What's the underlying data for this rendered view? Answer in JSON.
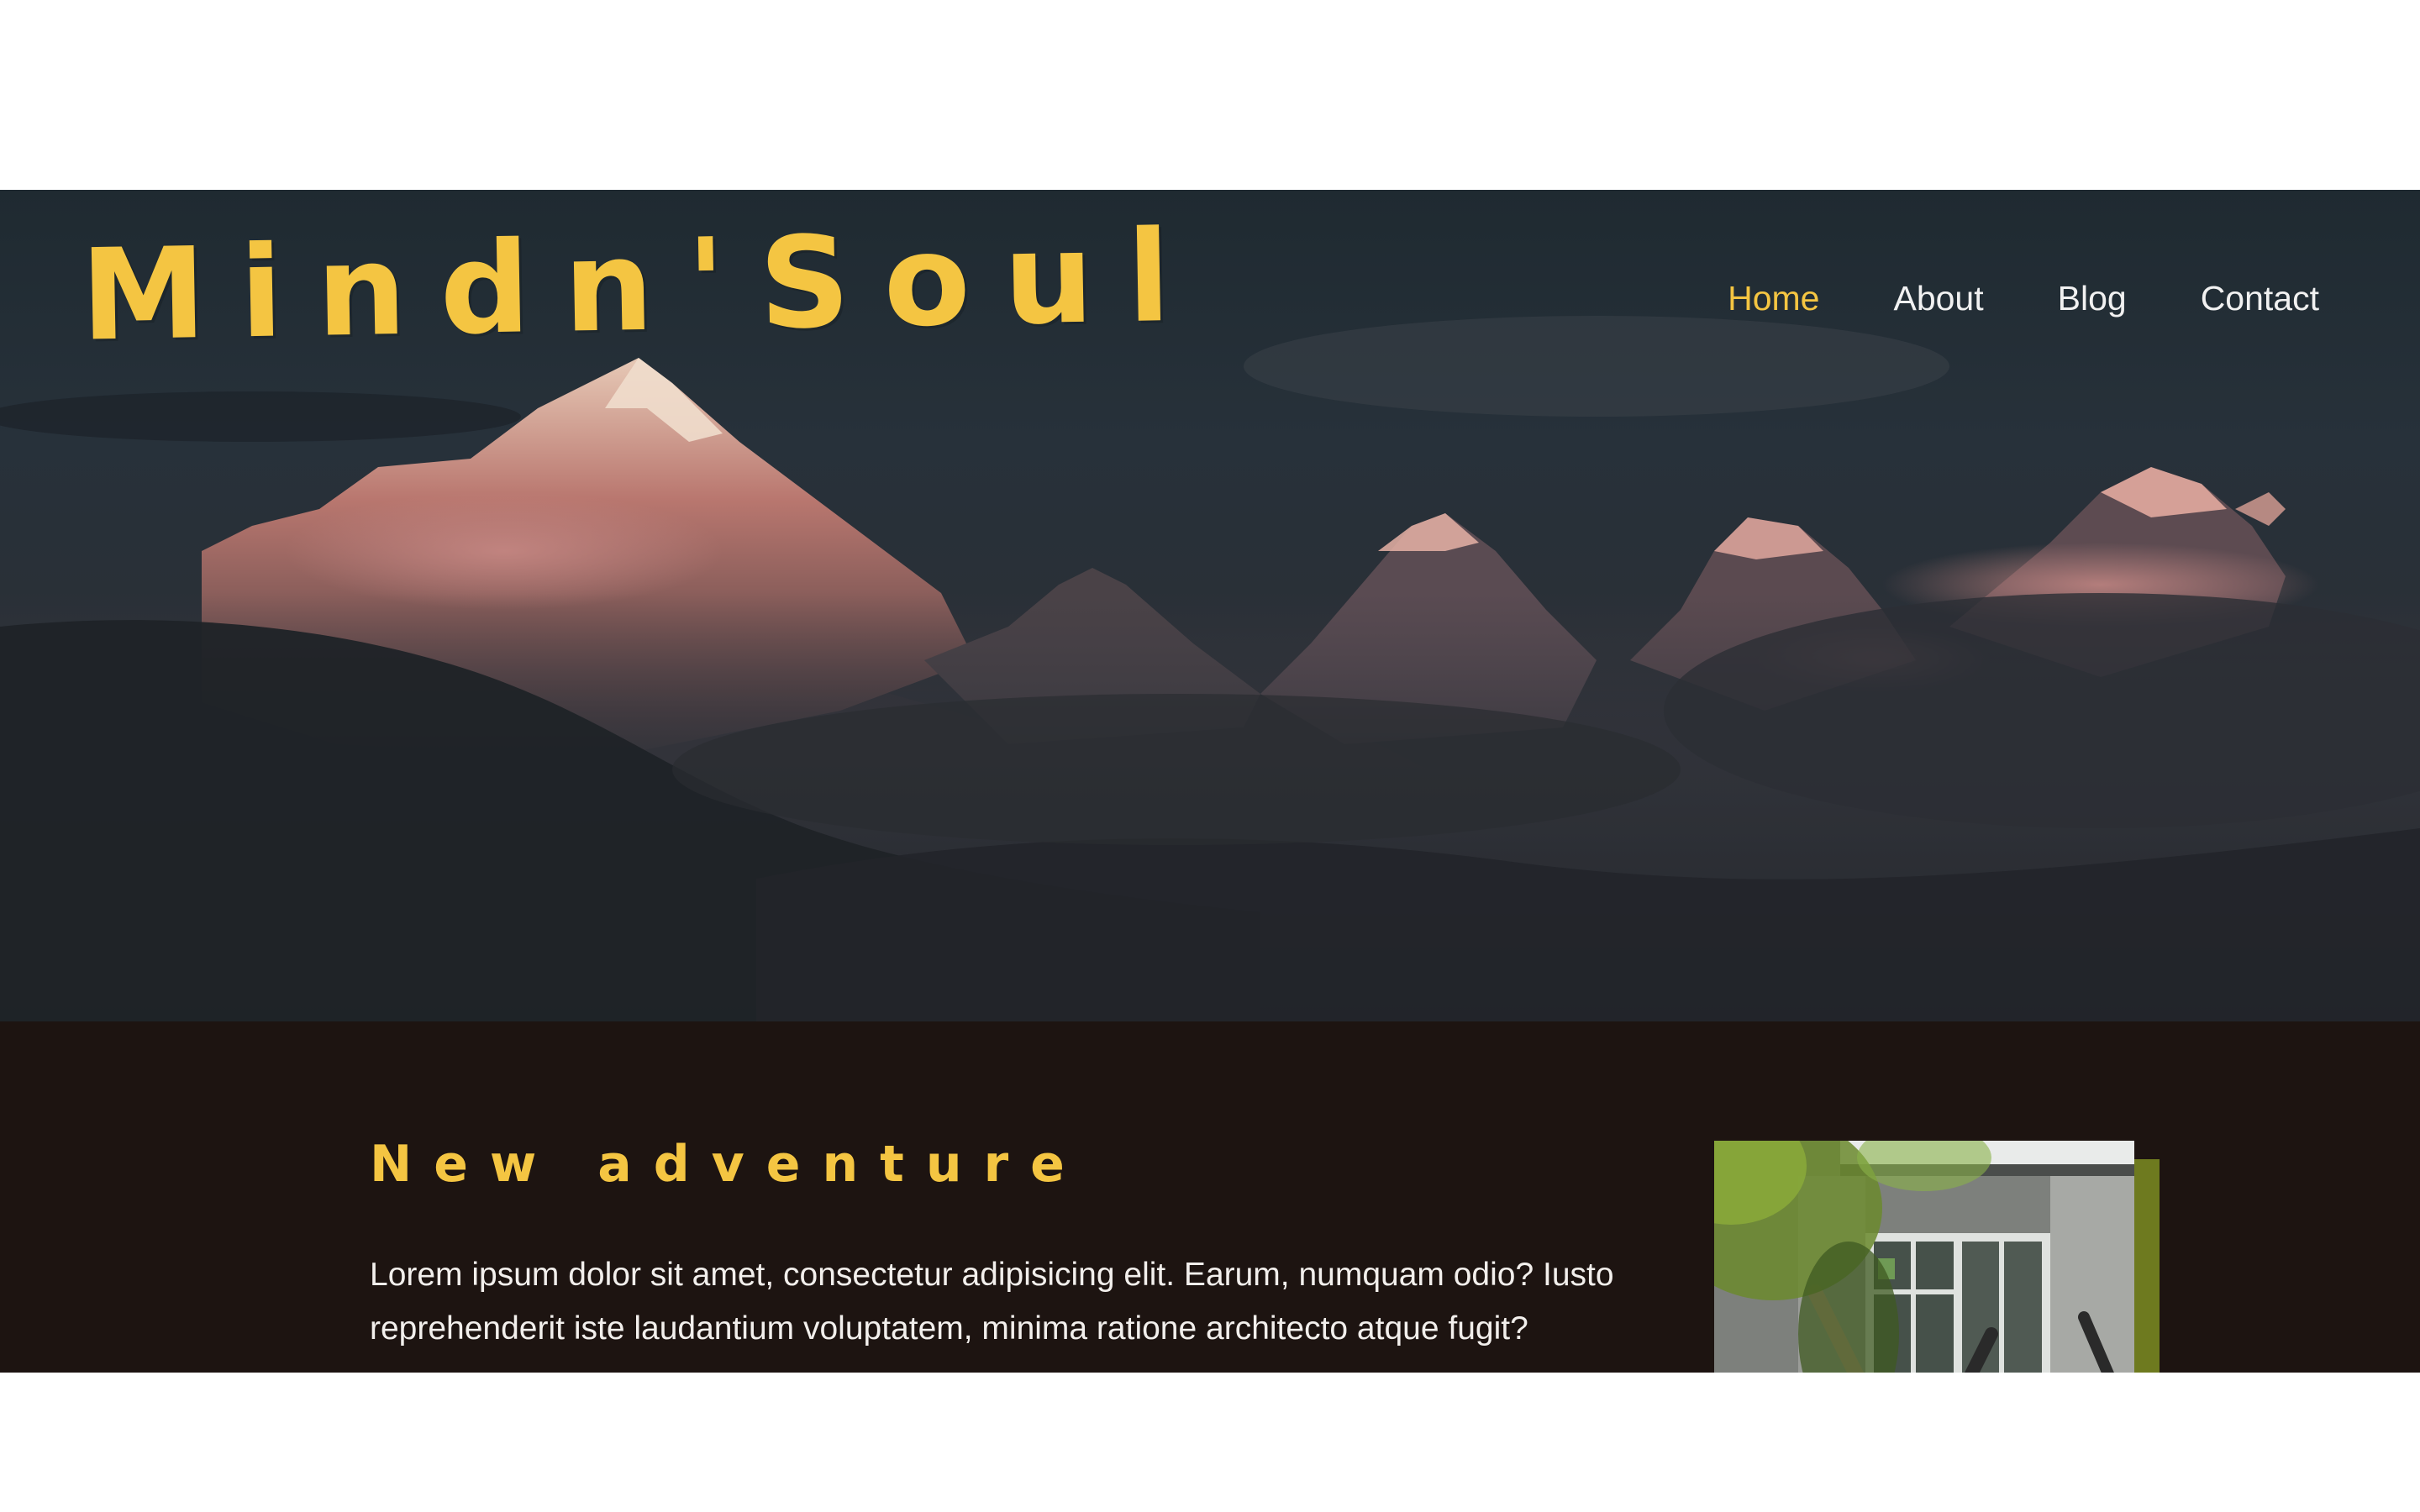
{
  "site": {
    "logo": "Mindn'Soul"
  },
  "nav": {
    "items": [
      {
        "label": "Home",
        "active": true
      },
      {
        "label": "About",
        "active": false
      },
      {
        "label": "Blog",
        "active": false
      },
      {
        "label": "Contact",
        "active": false
      }
    ]
  },
  "hero": {
    "image": "mountain-range-at-dusk"
  },
  "article": {
    "title": "New adventure",
    "body": "Lorem ipsum dolor sit amet, consectetur adipisicing elit. Earum, numquam odio? Iusto reprehenderit iste laudantium voluptatem, minima ratione architecto atque fugit?",
    "image": "yoga-class-through-leaves"
  },
  "colors": {
    "accent": "#f4c542",
    "hero_bg": "#27313a",
    "section_bg": "#1d1411",
    "photo_accent": "#6e7a1f",
    "text_light": "#f2efec"
  }
}
